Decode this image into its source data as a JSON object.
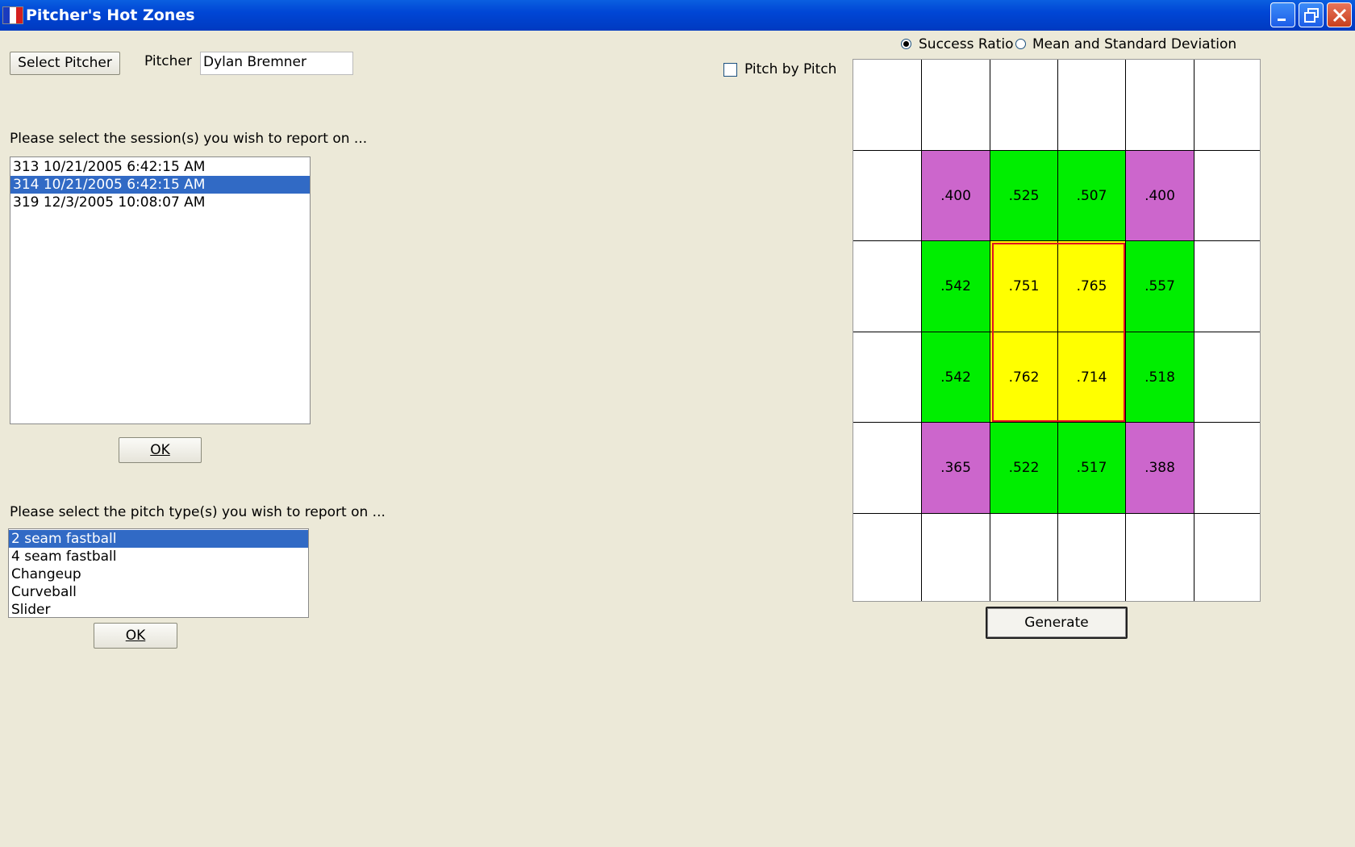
{
  "window": {
    "title": "Pitcher's Hot Zones"
  },
  "pitcher": {
    "select_button": "Select Pitcher",
    "label": "Pitcher",
    "value": "Dylan Bremner"
  },
  "sessions": {
    "prompt": "Please select the session(s) you wish to report on ...",
    "items": [
      {
        "label": "313 10/21/2005 6:42:15 AM",
        "selected": false
      },
      {
        "label": "314 10/21/2005 6:42:15 AM",
        "selected": true
      },
      {
        "label": "319 12/3/2005 10:08:07 AM",
        "selected": false
      }
    ],
    "ok_label": "OK"
  },
  "pitch_types": {
    "prompt": "Please select the pitch type(s) you wish to report on ...",
    "items": [
      {
        "label": "2 seam fastball",
        "selected": true
      },
      {
        "label": "4 seam fastball",
        "selected": false
      },
      {
        "label": "Changeup",
        "selected": false
      },
      {
        "label": "Curveball",
        "selected": false
      },
      {
        "label": "Slider",
        "selected": false
      }
    ],
    "ok_label": "OK"
  },
  "options": {
    "success_ratio": "Success Ratio",
    "mean_std": "Mean and Standard Deviation",
    "selected_mode": "success_ratio",
    "pitch_by_pitch": "Pitch by Pitch",
    "pitch_by_pitch_checked": false
  },
  "zone_grid": {
    "rows": [
      [
        "",
        "",
        "",
        "",
        "",
        ""
      ],
      [
        "",
        ".400",
        ".525",
        ".507",
        ".400",
        ""
      ],
      [
        "",
        ".542",
        ".751",
        ".765",
        ".557",
        ""
      ],
      [
        "",
        ".542",
        ".762",
        ".714",
        ".518",
        ""
      ],
      [
        "",
        ".365",
        ".522",
        ".517",
        ".388",
        ""
      ],
      [
        "",
        "",
        "",
        "",
        "",
        ""
      ]
    ],
    "colors": {
      "cold": "#cc66cc",
      "warm": "#00ee00",
      "hot": "#ffff00",
      "empty": "#ffffff",
      "strike_zone_border": "#e01020"
    },
    "heat": [
      [
        "empty",
        "empty",
        "empty",
        "empty",
        "empty",
        "empty"
      ],
      [
        "empty",
        "cold",
        "warm",
        "warm",
        "cold",
        "empty"
      ],
      [
        "empty",
        "warm",
        "hot",
        "hot",
        "warm",
        "empty"
      ],
      [
        "empty",
        "warm",
        "hot",
        "hot",
        "warm",
        "empty"
      ],
      [
        "empty",
        "cold",
        "warm",
        "warm",
        "cold",
        "empty"
      ],
      [
        "empty",
        "empty",
        "empty",
        "empty",
        "empty",
        "empty"
      ]
    ]
  },
  "generate_label": "Generate"
}
